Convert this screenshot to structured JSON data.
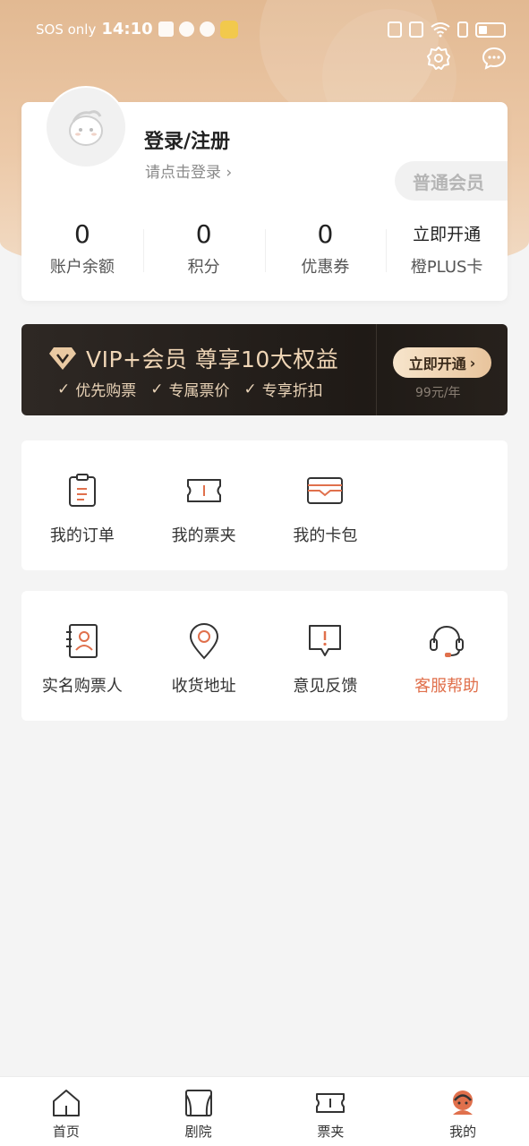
{
  "status_bar": {
    "carrier": "SOS only",
    "time": "14:10"
  },
  "profile": {
    "title": "登录/注册",
    "subtitle": "请点击登录",
    "member_level": "普通会员",
    "stats": [
      {
        "value": "0",
        "label": "账户余额"
      },
      {
        "value": "0",
        "label": "积分"
      },
      {
        "value": "0",
        "label": "优惠券"
      },
      {
        "value": "立即开通",
        "label": "橙PLUS卡"
      }
    ]
  },
  "vip": {
    "title": "VIP+会员  尊享10大权益",
    "features": [
      "优先购票",
      "专属票价",
      "专享折扣"
    ],
    "button": "立即开通",
    "price": "99元/年"
  },
  "orders_section": {
    "items": [
      {
        "label": "我的订单",
        "icon": "order-icon"
      },
      {
        "label": "我的票夹",
        "icon": "ticket-icon"
      },
      {
        "label": "我的卡包",
        "icon": "card-wallet-icon"
      }
    ]
  },
  "services_section": {
    "items": [
      {
        "label": "实名购票人",
        "icon": "contact-card-icon"
      },
      {
        "label": "收货地址",
        "icon": "location-pin-icon"
      },
      {
        "label": "意见反馈",
        "icon": "feedback-icon"
      },
      {
        "label": "客服帮助",
        "icon": "headset-icon"
      }
    ]
  },
  "tabbar": {
    "items": [
      {
        "label": "首页",
        "icon": "home-icon"
      },
      {
        "label": "剧院",
        "icon": "theater-icon"
      },
      {
        "label": "票夹",
        "icon": "ticket-icon"
      },
      {
        "label": "我的",
        "icon": "profile-icon"
      }
    ],
    "active_index": 3
  },
  "colors": {
    "accent": "#e0704c",
    "hero": "#e2b992",
    "vip_gold": "#f0d6b6"
  }
}
